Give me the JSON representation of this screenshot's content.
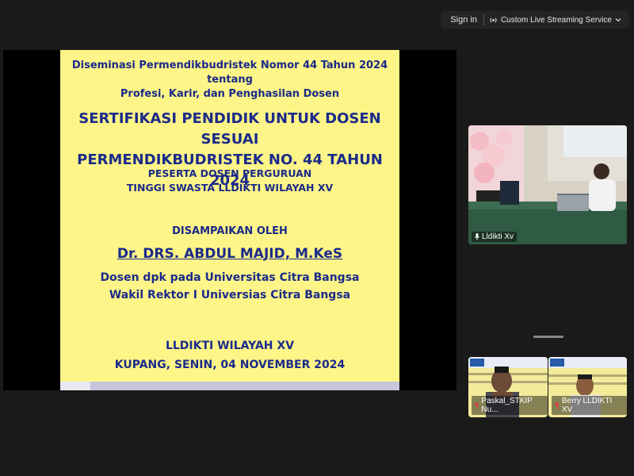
{
  "topbar": {
    "signin_label": "Sign in",
    "stream_label": "Custom Live Streaming Service"
  },
  "slide": {
    "line1": "Diseminasi Permendikbudristek Nomor 44 Tahun 2024 tentang",
    "line2": "Profesi, Karir, dan Penghasilan Dosen",
    "title1": "SERTIFIKASI PENDIDIK UNTUK DOSEN SESUAI",
    "title2": "PERMENDIKBUDRISTEK NO. 44 TAHUN 2024",
    "peserta1": "PESERTA DOSEN PERGURUAN",
    "peserta2": "TINGGI SWASTA LLDIKTI WILAYAH XV",
    "disampaikan": "DISAMPAIKAN OLEH",
    "speaker": "Dr. DRS. ABDUL  MAJID, M.KeS",
    "role1": "Dosen dpk pada Universitas Citra Bangsa",
    "role2": "Wakil Rektor I Universias Citra Bangsa",
    "org": "LLDIKTI WILAYAH XV",
    "place_date": "KUPANG, SENIN, 04 NOVEMBER 2024"
  },
  "participants": {
    "main": {
      "name": "Lldikti Xv"
    },
    "p1": {
      "name": "Paskal_STKIP Nu..."
    },
    "p2": {
      "name": "Berry LLDIKTI XV"
    }
  },
  "colors": {
    "slide_bg": "#fdf587",
    "slide_text": "#1b2a8a",
    "app_bg": "#1a1a1a"
  }
}
